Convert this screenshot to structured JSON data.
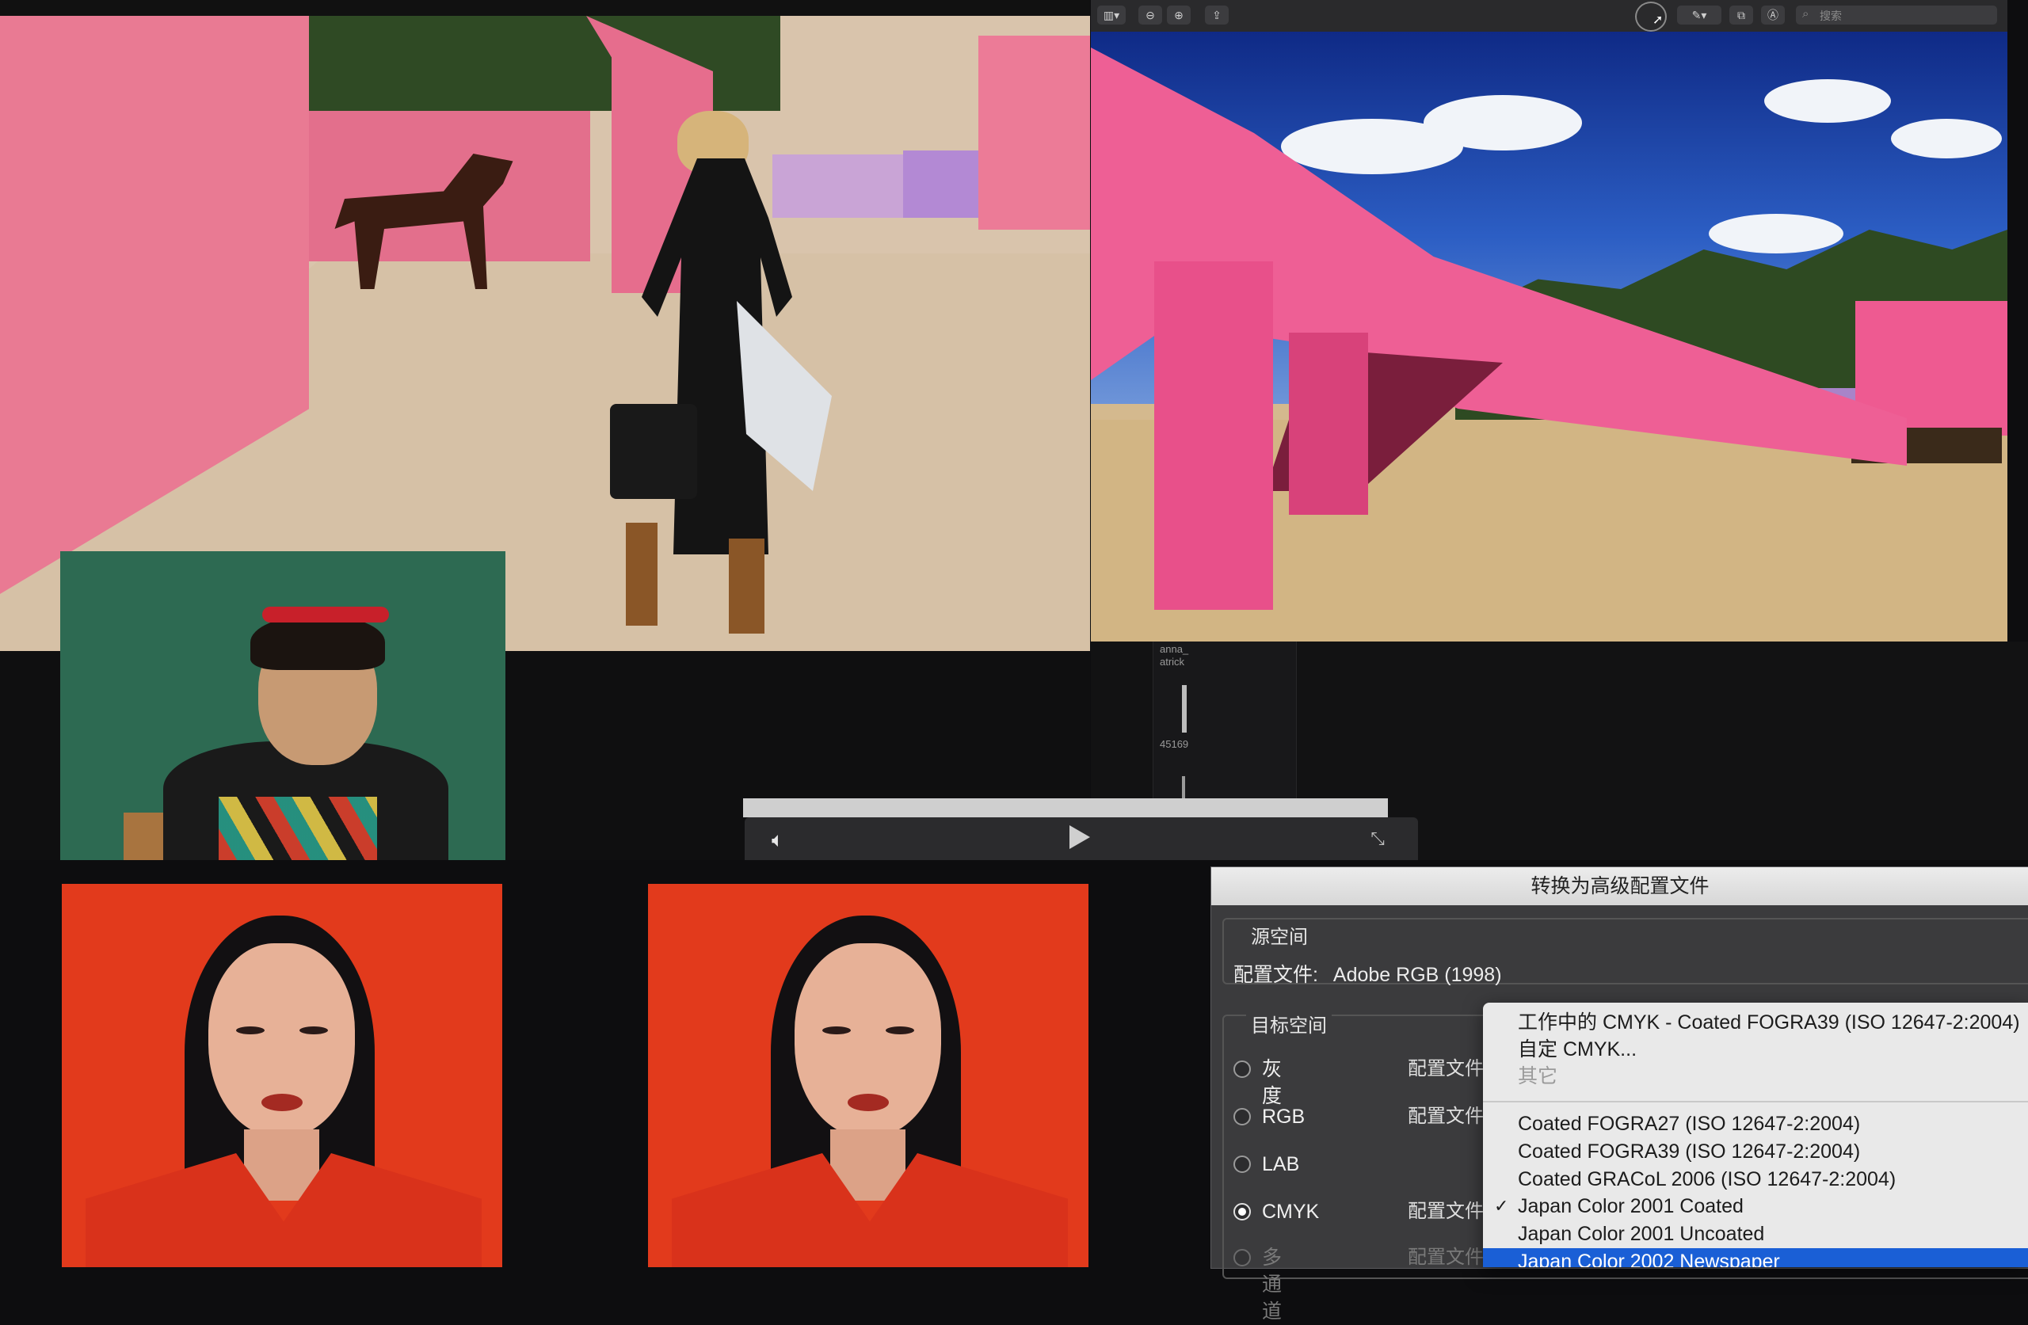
{
  "toolbar": {
    "search_placeholder": "搜索",
    "cursor_icon": "pointer-cursor-icon"
  },
  "strip": {
    "label1": "anna_",
    "label2": "atrick",
    "number": "45169"
  },
  "video_controls": {
    "volume_icon": "speaker-icon",
    "play_icon": "play-icon",
    "exit_fullscreen_icon": "shrink-icon"
  },
  "dialog": {
    "title": "转换为高级配置文件",
    "source_space_label": "源空间",
    "profile_label": "配置文件:",
    "profile_value": "Adobe RGB (1998)",
    "target_space_label": "目标空间",
    "modes": [
      {
        "label": "灰度",
        "selected": false
      },
      {
        "label": "RGB",
        "selected": false
      },
      {
        "label": "LAB",
        "selected": false
      },
      {
        "label": "CMYK",
        "selected": true
      },
      {
        "label": "多通道",
        "selected": false
      }
    ],
    "cfg_label": "配置文件"
  },
  "profile_menu": {
    "items_top": [
      "工作中的 CMYK - Coated FOGRA39 (ISO 12647-2:2004)",
      "自定 CMYK...",
      "其它"
    ],
    "items": [
      "Coated FOGRA27 (ISO 12647-2:2004)",
      "Coated FOGRA39 (ISO 12647-2:2004)",
      "Coated GRACoL 2006 (ISO 12647-2:2004)",
      "Japan Color 2001 Coated",
      "Japan Color 2001 Uncoated",
      "Japan Color 2002 Newspaper"
    ],
    "checked_item": "Japan Color 2001 Coated",
    "highlighted_item": "Japan Color 2002 Newspaper"
  }
}
